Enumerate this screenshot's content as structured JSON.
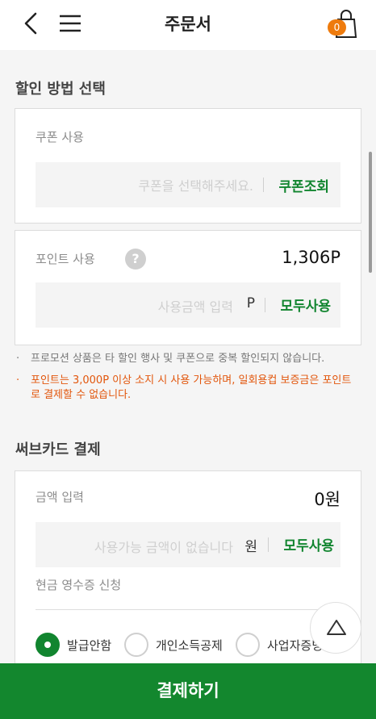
{
  "header": {
    "title": "주문서",
    "cart_count": "0",
    "back_icon": "back-chevron-icon",
    "menu_icon": "menu-icon",
    "cart_icon": "shopping-bag-icon"
  },
  "discount": {
    "section_title": "할인 방법 선택",
    "coupon": {
      "label": "쿠폰 사용",
      "placeholder": "쿠폰을 선택해주세요.",
      "lookup_button": "쿠폰조회"
    },
    "point": {
      "label": "포인트 사용",
      "help_icon": "?",
      "balance": "1,306P",
      "placeholder": "사용금액 입력",
      "unit": "P",
      "use_all_button": "모두사용"
    },
    "notices": [
      {
        "dot": "·",
        "text": "프로모션 상품은 타 할인 행사 및 쿠폰으로 중복 할인되지 않습니다."
      },
      {
        "dot": "·",
        "text": "포인트는 3,000P 이상 소지 시 사용 가능하며, 일회용컵 보증금은 포인트로 결제할 수 없습니다."
      }
    ]
  },
  "subcard": {
    "section_title": "써브카드 결제",
    "amount_label": "금액 입력",
    "amount_value": "0원",
    "placeholder": "사용가능 금액이 없습니다",
    "unit": "원",
    "use_all_button": "모두사용",
    "receipt_label": "현금 영수증 신청",
    "receipt_options": [
      {
        "label": "발급안함",
        "selected": true
      },
      {
        "label": "개인소득공제",
        "selected": false
      },
      {
        "label": "사업자증빙",
        "selected": false
      }
    ]
  },
  "footer": {
    "pay_button": "결제하기",
    "scroll_top_icon": "triangle-up-icon"
  },
  "colors": {
    "accent_green": "#13872e",
    "badge_orange": "#ee7b0d",
    "notice_orange": "#e2560c"
  }
}
